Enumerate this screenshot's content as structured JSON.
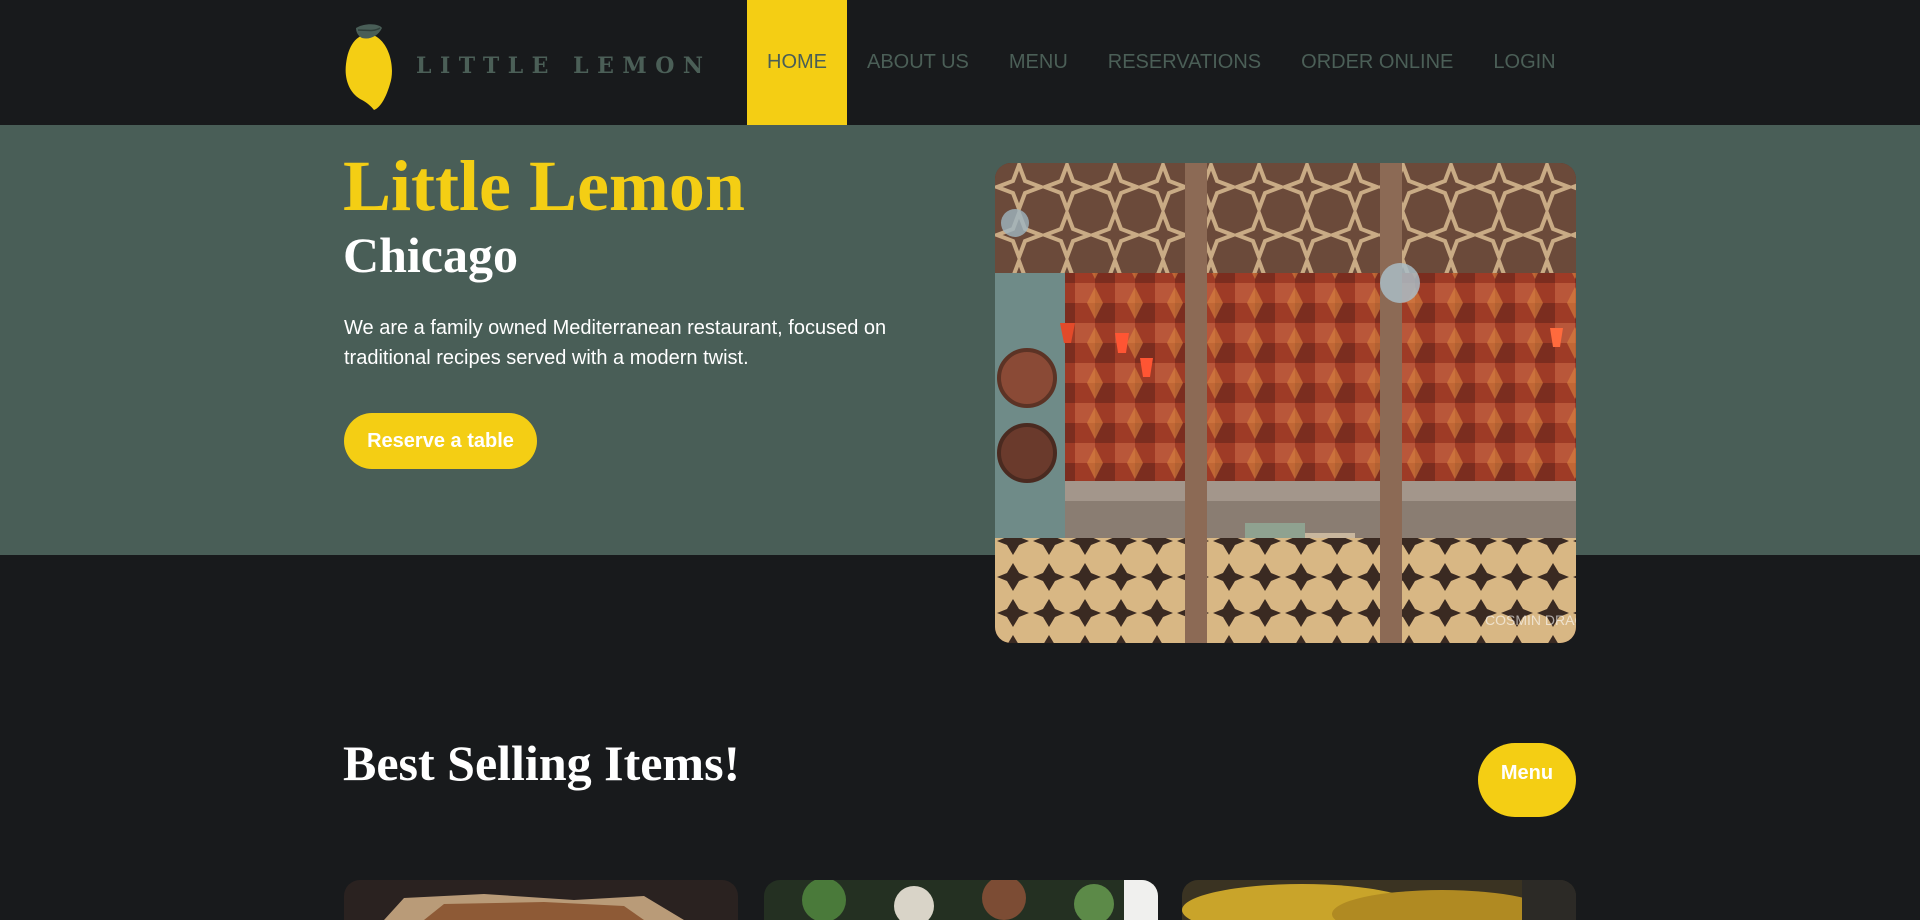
{
  "header": {
    "logo_text": "LITTLE LEMON",
    "nav": [
      {
        "label": "HOME",
        "active": true
      },
      {
        "label": "ABOUT US"
      },
      {
        "label": "MENU"
      },
      {
        "label": "RESERVATIONS"
      },
      {
        "label": "ORDER ONLINE"
      },
      {
        "label": "LOGIN"
      }
    ]
  },
  "hero": {
    "title": "Little Lemon",
    "subtitle": "Chicago",
    "description": "We are a family owned Mediterranean restaurant, focused on traditional recipes served with a modern twist.",
    "cta_label": "Reserve a table",
    "image_watermark": "COSMIN DRAGU"
  },
  "specials": {
    "title": "Best Selling Items!",
    "menu_button": "Menu"
  },
  "colors": {
    "primary_green": "#495e57",
    "primary_yellow": "#f4ce14",
    "dark_background": "#181a1c"
  }
}
